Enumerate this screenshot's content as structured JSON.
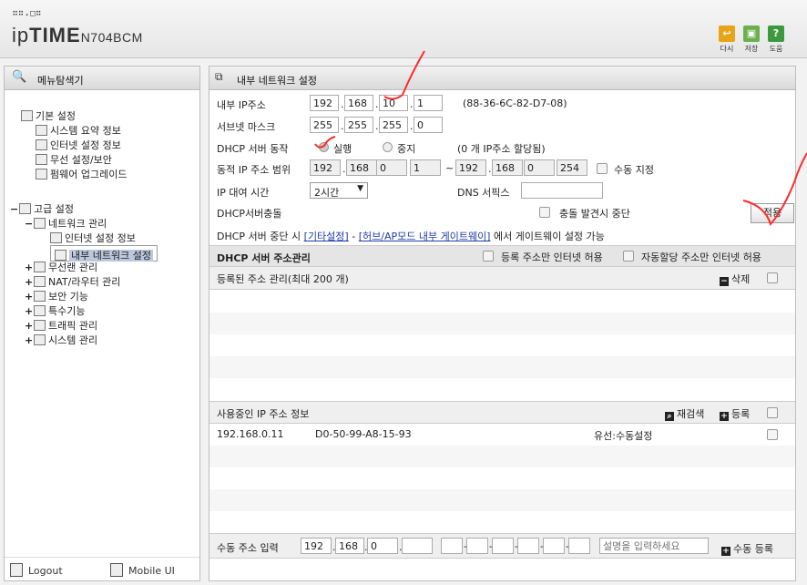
{
  "header": {
    "logo_dots": "∷∷.□∷",
    "logo_ip": "ip",
    "logo_time": "TIME",
    "model": "N704BCM",
    "buttons": [
      {
        "label": "다시",
        "icon": "undo-icon",
        "color": "#e8a317"
      },
      {
        "label": "저장",
        "icon": "save-icon",
        "color": "#6ab04c"
      },
      {
        "label": "도움",
        "icon": "help-icon",
        "color": "#3c9a3c"
      }
    ]
  },
  "left": {
    "title": "메뉴탐색기",
    "tree": {
      "basic": "기본 설정",
      "sys_summary": "시스템 요약 정보",
      "internet_setup": "인터넷 설정 정보",
      "wireless_setup": "무선 설정/보안",
      "firmware": "펌웨어 업그레이드",
      "advanced": "고급 설정",
      "network_mgmt": "네트워크 관리",
      "internet_info": "인터넷 설정 정보",
      "internal_net": "내부 네트워크 설정",
      "wlan_mgmt": "무선랜 관리",
      "nat_mgmt": "NAT/라우터 관리",
      "security": "보안 기능",
      "special": "특수기능",
      "traffic": "트래픽 관리",
      "system_mgmt": "시스템 관리"
    },
    "logout": "Logout",
    "mobile": "Mobile UI"
  },
  "main": {
    "title": "내부 네트워크 설정",
    "ip_label": "내부 IP주소",
    "ip": [
      "192",
      "168",
      "10",
      "1"
    ],
    "mac": "(88-36-6C-82-D7-08)",
    "mask_label": "서브넷 마스크",
    "mask": [
      "255",
      "255",
      "255",
      "0"
    ],
    "dhcp_label": "DHCP 서버 동작",
    "dhcp_on": "실행",
    "dhcp_off": "중지",
    "dhcp_count": "(0 개 IP주소 할당됨)",
    "range_label": "동적 IP 주소 범위",
    "range_start": [
      "192",
      "168",
      "0",
      "1"
    ],
    "range_tilde": "~",
    "range_end": [
      "192",
      "168",
      "0",
      "254"
    ],
    "manual_label": "수동 지정",
    "lease_label": "IP 대여 시간",
    "lease_value": "2시간",
    "dns_label": "DNS 서픽스",
    "conflict_label": "DHCP서버충돌",
    "conflict_stop": "충돌 발견시 중단",
    "apply": "적용",
    "stop_note_pre": "DHCP 서버 중단 시",
    "stop_link1": "[기타설정]",
    "stop_dash": "-",
    "stop_link2": "[허브/AP모드 내부 게이트웨이]",
    "stop_note_post": "에서 게이트웨이 설정 가능",
    "addr_mgmt": "DHCP 서버 주소관리",
    "reg_only": "등록 주소만 인터넷 허용",
    "auto_only": "자동할당 주소만 인터넷 허용",
    "registered": "등록된 주소 관리(최대 200 개)",
    "delete": "삭제",
    "inuse": "사용중인 IP 주소 정보",
    "rescan": "재검색",
    "register": "등록",
    "inuse_rows": [
      {
        "ip": "192.168.0.11",
        "mac": "D0-50-99-A8-15-93",
        "type": "유선:수동설정"
      }
    ],
    "manual_input": "수동 주소 입력",
    "manual_ip": [
      "192",
      "168",
      "0",
      ""
    ],
    "desc_placeholder": "설명을 입력하세요",
    "manual_register": "수동 등록"
  }
}
